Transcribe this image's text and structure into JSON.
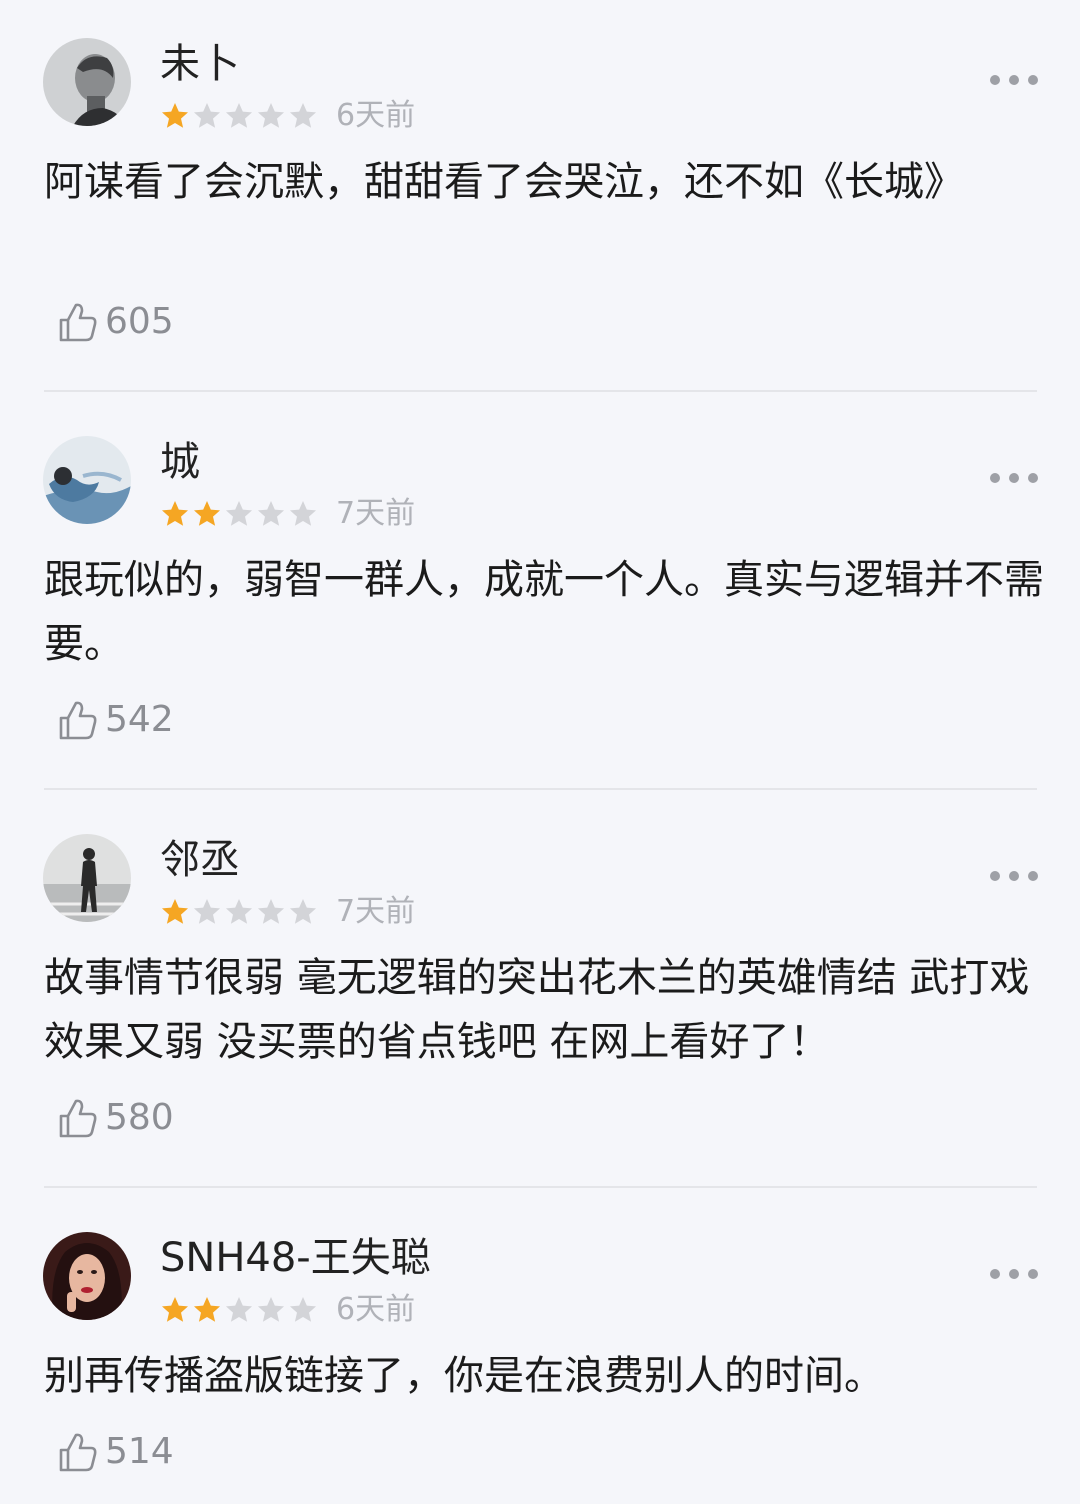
{
  "colors": {
    "background": "#f5f6fa",
    "star_active": "#f5a623",
    "star_inactive": "#d3d4d8",
    "meta_text": "#b0b2b8"
  },
  "reviews": [
    {
      "username": "未卜",
      "rating": 1,
      "max_rating": 5,
      "date": "6天前",
      "content": "阿谋看了会沉默，甜甜看了会哭泣，还不如《长城》",
      "likes": "605",
      "avatar_icon": "portrait-photo-avatar",
      "more_icon": "more-dots-icon"
    },
    {
      "username": "城",
      "rating": 2,
      "max_rating": 5,
      "date": "7天前",
      "content": "跟玩似的，弱智一群人，成就一个人。真实与逻辑并不需要。",
      "likes": "542",
      "avatar_icon": "sky-photo-avatar",
      "more_icon": "more-dots-icon"
    },
    {
      "username": "邻丞",
      "rating": 1,
      "max_rating": 5,
      "date": "7天前",
      "content": "故事情节很弱 毫无逻辑的突出花木兰的英雄情结 武打戏效果又弱 没买票的省点钱吧 在网上看好了！",
      "likes": "580",
      "avatar_icon": "walking-figure-avatar",
      "more_icon": "more-dots-icon"
    },
    {
      "username": "SNH48-王失聪",
      "rating": 2,
      "max_rating": 5,
      "date": "6天前",
      "content": "别再传播盗版链接了，你是在浪费别人的时间。",
      "likes": "514",
      "avatar_icon": "woman-photo-avatar",
      "more_icon": "more-dots-icon"
    }
  ]
}
